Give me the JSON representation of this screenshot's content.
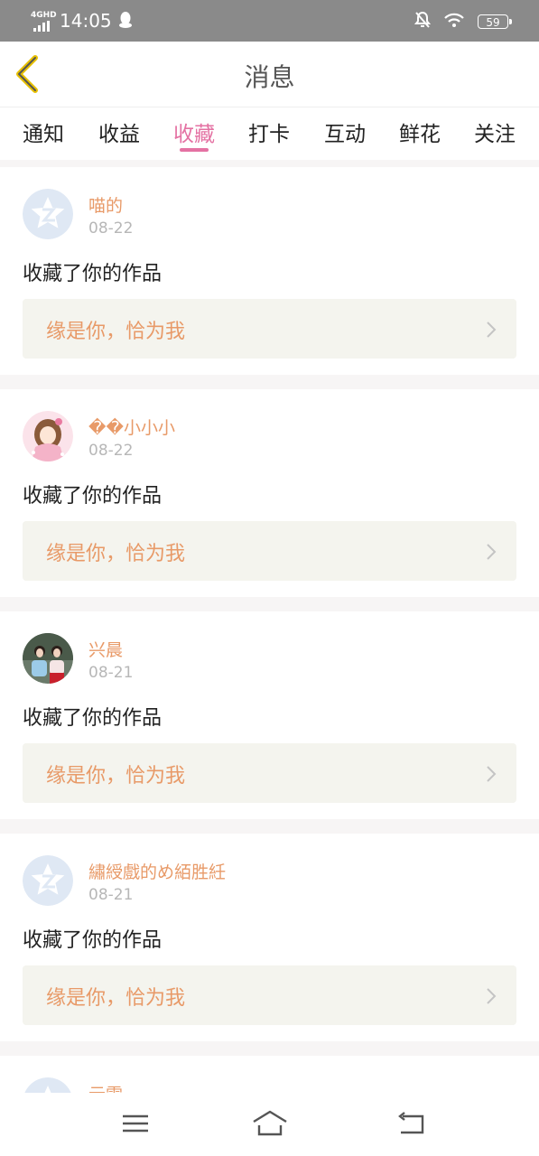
{
  "status_bar": {
    "network": "4GHD",
    "time": "14:05",
    "battery": "59"
  },
  "header": {
    "title": "消息"
  },
  "tabs": [
    {
      "label": "通知"
    },
    {
      "label": "收益"
    },
    {
      "label": "收藏",
      "active": true
    },
    {
      "label": "打卡"
    },
    {
      "label": "互动"
    },
    {
      "label": "鲜花"
    },
    {
      "label": "关注"
    }
  ],
  "items": [
    {
      "user": "喵的",
      "date": "08-22",
      "action": "收藏了你的作品",
      "work": "缘是你，恰为我",
      "avatar": "default-avatar-icon"
    },
    {
      "user": "��小小小",
      "date": "08-22",
      "action": "收藏了你的作品",
      "work": "缘是你，恰为我",
      "avatar": "cartoon-girl-avatar"
    },
    {
      "user": "兴晨",
      "date": "08-21",
      "action": "收藏了你的作品",
      "work": "缘是你，恰为我",
      "avatar": "photo-avatar"
    },
    {
      "user": "繡綬戲的め絔胜紝",
      "date": "08-21",
      "action": "收藏了你的作品",
      "work": "缘是你，恰为我",
      "avatar": "default-avatar-icon"
    },
    {
      "user": "云雪",
      "avatar": "default-avatar-icon"
    }
  ],
  "colors": {
    "accent": "#e472a3",
    "username": "#e89a68",
    "status_bar": "#8a8a8a",
    "back_arrow": "#e8c000"
  }
}
